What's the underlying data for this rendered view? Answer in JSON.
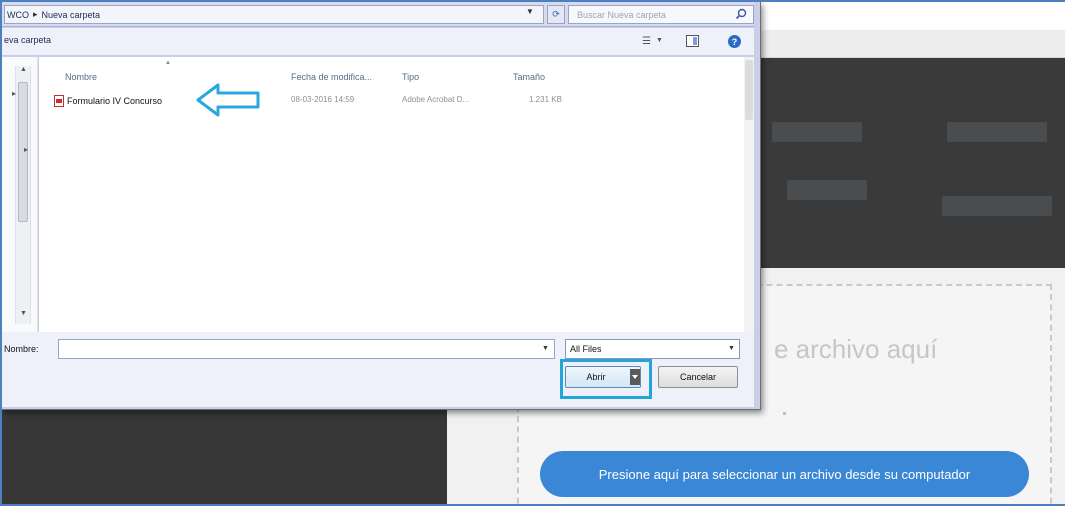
{
  "dialog": {
    "address": {
      "path": [
        "WCO",
        "Nueva carpeta"
      ],
      "separator": "▸",
      "search_placeholder": "Buscar Nueva carpeta"
    },
    "toolbar": {
      "crumb": "eva carpeta"
    },
    "columns": {
      "name": "Nombre",
      "date": "Fecha de modifica...",
      "type": "Tipo",
      "size": "Tamaño"
    },
    "files": [
      {
        "name": "Formulario IV Concurso",
        "date": "08-03-2016 14:59",
        "type": "Adobe Acrobat D...",
        "size": "1.231 KB",
        "icon": "pdf-icon"
      }
    ],
    "bottom": {
      "name_label": "Nombre:",
      "name_value": "",
      "filter": "All Files",
      "open_label": "Abrir",
      "cancel_label": "Cancelar"
    }
  },
  "page": {
    "drop_text": "e archivo aquí",
    "select_button": "Presione aquí para seleccionar un archivo desde su computador"
  },
  "colors": {
    "accent": "#3a87d6",
    "highlight": "#24a4d8",
    "arrow": "#2aa7de"
  }
}
